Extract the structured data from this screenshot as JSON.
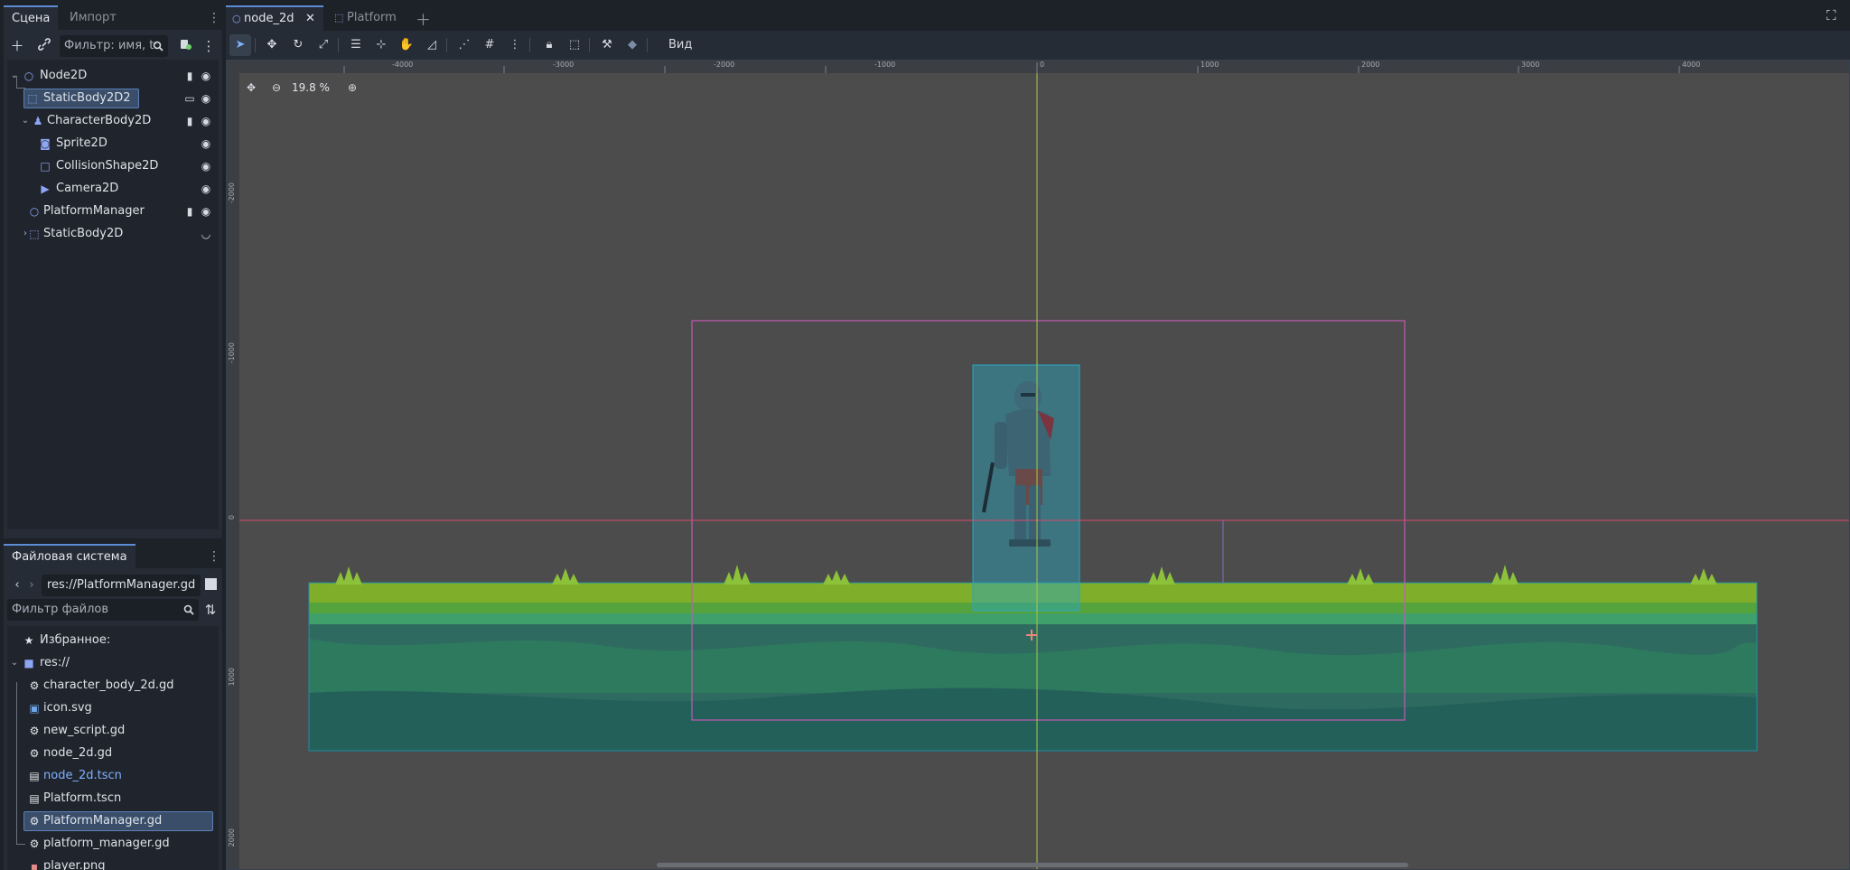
{
  "scene_panel": {
    "tabs": [
      {
        "label": "Сцена"
      },
      {
        "label": "Импорт"
      }
    ],
    "filter_placeholder": "Фильтр: имя, t:",
    "nodes": [
      {
        "label": "Node2D",
        "icon": "node2d-icon"
      },
      {
        "label": "StaticBody2D2",
        "icon": "static-body-icon"
      },
      {
        "label": "CharacterBody2D",
        "icon": "character-body-icon"
      },
      {
        "label": "Sprite2D",
        "icon": "sprite-icon"
      },
      {
        "label": "CollisionShape2D",
        "icon": "collision-shape-icon"
      },
      {
        "label": "Camera2D",
        "icon": "camera-icon"
      },
      {
        "label": "PlatformManager",
        "icon": "node2d-icon"
      },
      {
        "label": "StaticBody2D",
        "icon": "static-body-icon"
      }
    ]
  },
  "filesystem_panel": {
    "title": "Файловая система",
    "path": "res://PlatformManager.gd",
    "filter_placeholder": "Фильтр файлов",
    "favorites_label": "Избранное:",
    "root_label": "res://",
    "files": [
      {
        "label": "character_body_2d.gd",
        "icon": "gear-icon"
      },
      {
        "label": "icon.svg",
        "icon": "image-icon"
      },
      {
        "label": "new_script.gd",
        "icon": "gear-icon"
      },
      {
        "label": "node_2d.gd",
        "icon": "gear-icon"
      },
      {
        "label": "node_2d.tscn",
        "icon": "scene-icon"
      },
      {
        "label": "Platform.tscn",
        "icon": "scene-icon"
      },
      {
        "label": "PlatformManager.gd",
        "icon": "gear-icon"
      },
      {
        "label": "platform_manager.gd",
        "icon": "gear-icon"
      },
      {
        "label": "player.png",
        "icon": "image-icon"
      }
    ]
  },
  "doc_tabs": [
    {
      "label": "node_2d"
    },
    {
      "label": "Platform"
    }
  ],
  "toolbar": {
    "view_label": "Вид"
  },
  "viewport": {
    "zoom_label": "19.8 %",
    "ruler_h_labels": [
      "-4000",
      "-3000",
      "-2000",
      "-1000",
      "0",
      "1000",
      "2000",
      "3000",
      "4000"
    ],
    "ruler_v_labels": [
      "-2000",
      "-1000",
      "0",
      "1000",
      "2000"
    ]
  },
  "colors": {
    "accent": "#5d8bd4",
    "selection": "#3a4e6a",
    "viewport_bg": "#4c4c4c",
    "x_axis": "#d94a6b",
    "y_axis": "#a7c94a",
    "camera_rect": "#c25bb3",
    "collision": "#2aa7c2"
  }
}
